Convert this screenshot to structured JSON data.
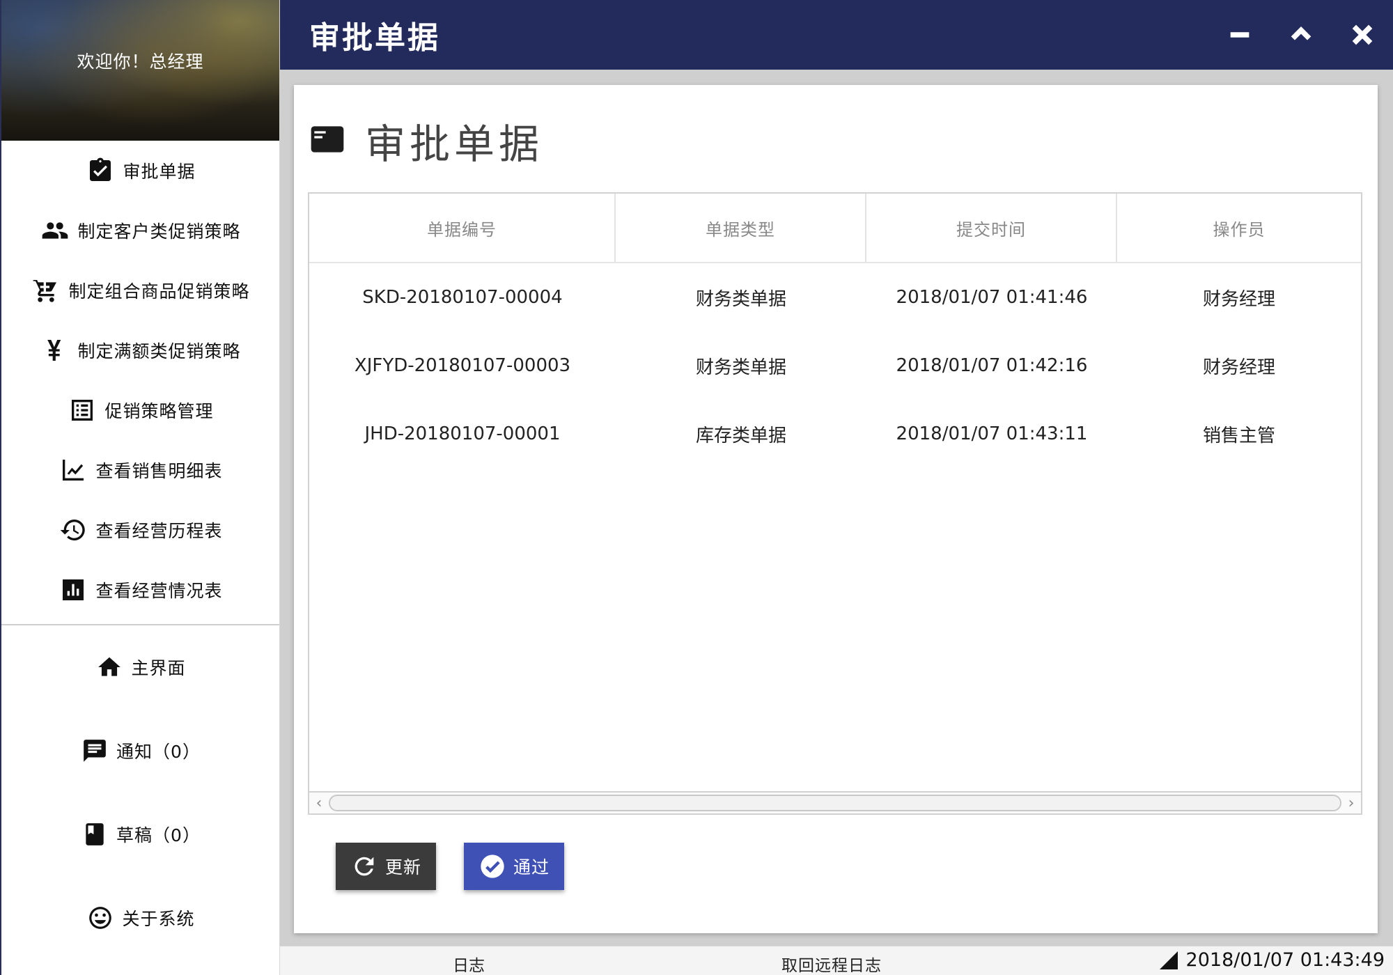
{
  "sidebar": {
    "welcome": "欢迎你！总经理",
    "nav": [
      {
        "label": "审批单据",
        "icon": "clipboard-check-icon"
      },
      {
        "label": "制定客户类促销策略",
        "icon": "people-icon"
      },
      {
        "label": "制定组合商品促销策略",
        "icon": "cart-icon"
      },
      {
        "label": "制定满额类促销策略",
        "icon": "yen-icon"
      },
      {
        "label": "促销策略管理",
        "icon": "list-icon"
      },
      {
        "label": "查看销售明细表",
        "icon": "trend-chart-icon"
      },
      {
        "label": "查看经营历程表",
        "icon": "history-icon"
      },
      {
        "label": "查看经营情况表",
        "icon": "bar-chart-icon"
      }
    ],
    "bottom": [
      {
        "label": "主界面",
        "icon": "home-icon"
      },
      {
        "label": "通知（0）",
        "icon": "message-icon"
      },
      {
        "label": "草稿（0）",
        "icon": "book-icon"
      },
      {
        "label": "关于系统",
        "icon": "smile-icon"
      }
    ]
  },
  "titlebar": {
    "title": "审批单据",
    "controls": [
      "minimize-icon",
      "chevron-up-icon",
      "close-icon"
    ]
  },
  "main": {
    "heading": "审批单据",
    "heading_icon": "card-icon",
    "table": {
      "columns": [
        "单据编号",
        "单据类型",
        "提交时间",
        "操作员"
      ],
      "rows": [
        [
          "SKD-20180107-00004",
          "财务类单据",
          "2018/01/07 01:41:46",
          "财务经理"
        ],
        [
          "XJFYD-20180107-00003",
          "财务类单据",
          "2018/01/07 01:42:16",
          "财务经理"
        ],
        [
          "JHD-20180107-00001",
          "库存类单据",
          "2018/01/07 01:43:11",
          "销售主管"
        ]
      ]
    },
    "buttons": {
      "refresh": "更新",
      "pass": "通过"
    }
  },
  "statusbar": {
    "log": "日志",
    "remote_log": "取回远程日志",
    "clock": "2018/01/07 01:43:49"
  },
  "colors": {
    "titlebar": "#232a5c",
    "pass_button": "#3f51b5",
    "refresh_button": "#3b3b3b"
  }
}
